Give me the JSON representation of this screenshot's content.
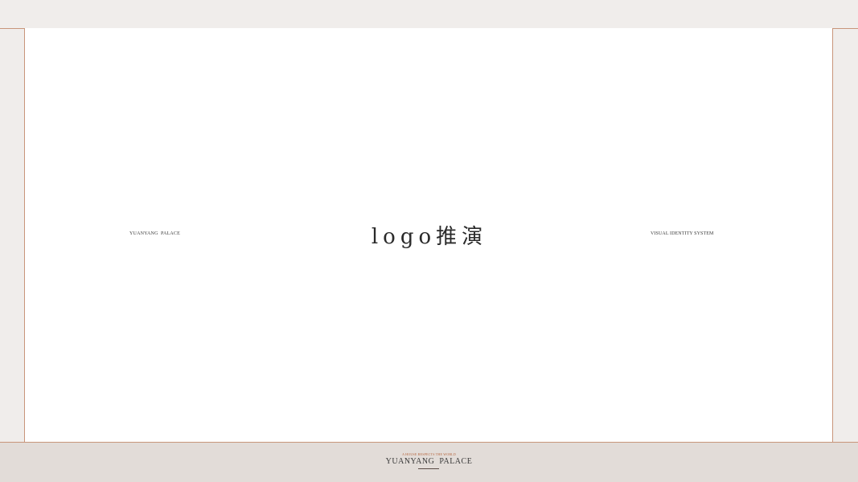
{
  "slide": {
    "left_label": "YUANYANG  PALACE",
    "center_title": "logo推演",
    "right_label": "VISUAL IDENTITY SYSTEM"
  },
  "footer": {
    "tagline": "A HOUSE BESPECTS THE WORLD",
    "brand": "YUANYANG  PALACE"
  },
  "colors": {
    "background": "#f0edeb",
    "panel": "#ffffff",
    "frame_line": "#c8957a",
    "footer_background": "#e2dcd8",
    "tagline_accent": "#b5643d",
    "text": "#2a2a2a"
  }
}
